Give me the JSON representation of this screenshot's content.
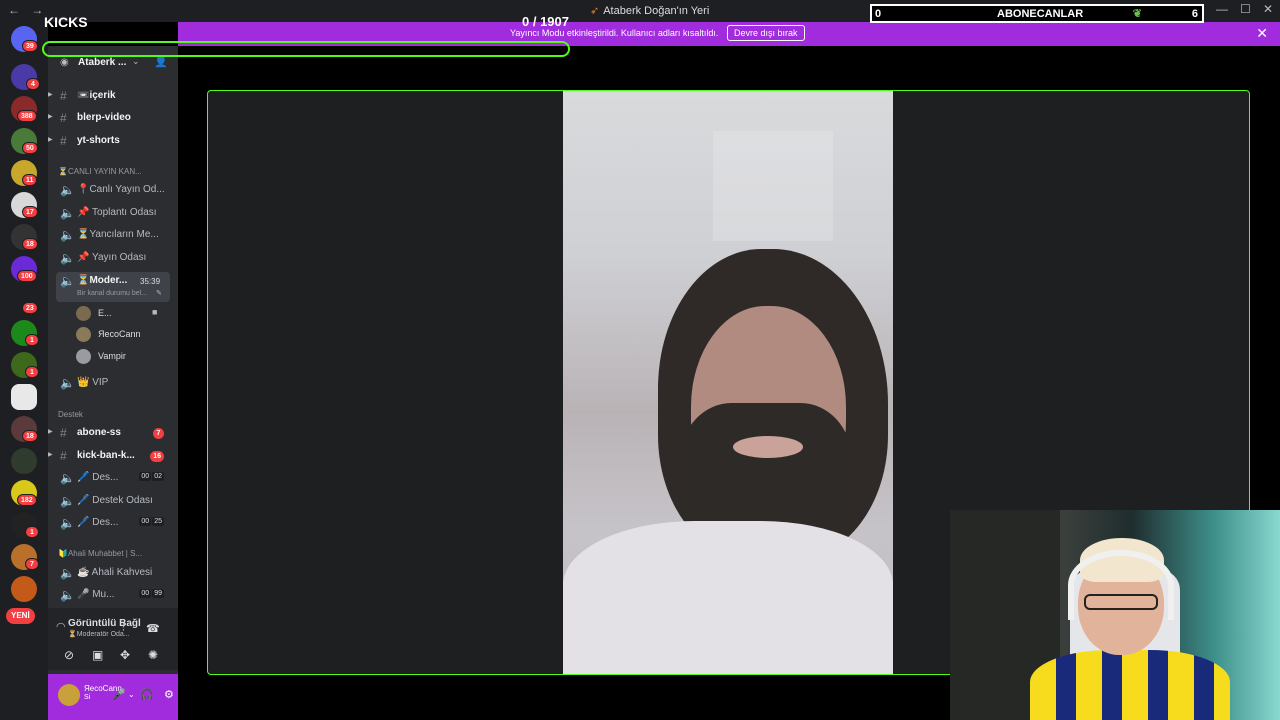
{
  "titlebar": {
    "back": "←",
    "forward": "→",
    "title": "Ataberk Doğan'ın Yeri",
    "minimize": "—",
    "maximize": "☐",
    "close": "✕"
  },
  "overlay": {
    "kicks_label": "KICKS",
    "counter": "0 / 1907",
    "progress_fraction": 0,
    "subs_left": "0",
    "subs_title": "ABONECANLAR",
    "subs_right": "6"
  },
  "banner": {
    "message": "Yayıncı Modu etkinleştirildi. Kullanıcı adları kısaltıldı.",
    "button": "Devre dışı bırak",
    "close": "✕"
  },
  "rail": {
    "badges": [
      "39",
      "4",
      "388",
      "50",
      "11",
      "17",
      "18",
      "100",
      "23",
      "1",
      "1",
      "18",
      "182",
      "1",
      "7"
    ],
    "new_label": "YENİ"
  },
  "sidebar": {
    "server_name": "Ataberk ...",
    "channels_top": [
      {
        "label": "📼içerik"
      },
      {
        "label": "blerp-video"
      },
      {
        "label": "yt-shorts"
      }
    ],
    "category_live": "⏳CANLI YAYIN KAN...",
    "voice_channels": [
      {
        "label": "📍Canlı Yayın Od..."
      },
      {
        "label": "📌 Toplantı Odası"
      },
      {
        "label": "⏳Yancıların Me..."
      },
      {
        "label": "📌 Yayın Odası"
      }
    ],
    "selected_channel": {
      "label": "⏳Moder...",
      "timer": "35:39",
      "status": "Bir kanal durumu bel..."
    },
    "users": [
      {
        "name": "E..."
      },
      {
        "name": "ЯecoCann"
      },
      {
        "name": "Vampir"
      }
    ],
    "vip_channel": "👑 VIP",
    "category_support": "Destek",
    "support_channels": [
      {
        "label": "abone-ss",
        "badge": "7"
      },
      {
        "label": "kick-ban-k...",
        "badge": "16"
      }
    ],
    "support_voice": [
      {
        "label": "🖊️ Des...",
        "c1": "00",
        "c2": "02"
      },
      {
        "label": "🖊️ Destek Odası"
      },
      {
        "label": "🖊️ Des...",
        "c1": "00",
        "c2": "25"
      }
    ],
    "category_ahali": "🔰Ahali Muhabbet | S...",
    "ahali_channels": [
      {
        "label": "☕ Ahali Kahvesi"
      },
      {
        "label": "🎤 Mu...",
        "c1": "00",
        "c2": "99"
      }
    ]
  },
  "voice_panel": {
    "title": "Görüntülü Bağl",
    "subtitle": "⏳Moderatör Oda..."
  },
  "userbar": {
    "name": "ЯecoCann",
    "status": "Si"
  }
}
